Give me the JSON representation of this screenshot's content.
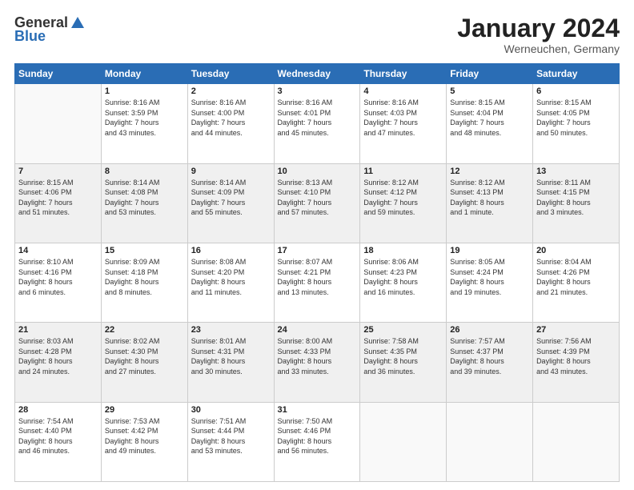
{
  "logo": {
    "general": "General",
    "blue": "Blue"
  },
  "header": {
    "month": "January 2024",
    "location": "Werneuchen, Germany"
  },
  "weekdays": [
    "Sunday",
    "Monday",
    "Tuesday",
    "Wednesday",
    "Thursday",
    "Friday",
    "Saturday"
  ],
  "weeks": [
    [
      {
        "day": "",
        "info": ""
      },
      {
        "day": "1",
        "info": "Sunrise: 8:16 AM\nSunset: 3:59 PM\nDaylight: 7 hours\nand 43 minutes."
      },
      {
        "day": "2",
        "info": "Sunrise: 8:16 AM\nSunset: 4:00 PM\nDaylight: 7 hours\nand 44 minutes."
      },
      {
        "day": "3",
        "info": "Sunrise: 8:16 AM\nSunset: 4:01 PM\nDaylight: 7 hours\nand 45 minutes."
      },
      {
        "day": "4",
        "info": "Sunrise: 8:16 AM\nSunset: 4:03 PM\nDaylight: 7 hours\nand 47 minutes."
      },
      {
        "day": "5",
        "info": "Sunrise: 8:15 AM\nSunset: 4:04 PM\nDaylight: 7 hours\nand 48 minutes."
      },
      {
        "day": "6",
        "info": "Sunrise: 8:15 AM\nSunset: 4:05 PM\nDaylight: 7 hours\nand 50 minutes."
      }
    ],
    [
      {
        "day": "7",
        "info": "Sunrise: 8:15 AM\nSunset: 4:06 PM\nDaylight: 7 hours\nand 51 minutes."
      },
      {
        "day": "8",
        "info": "Sunrise: 8:14 AM\nSunset: 4:08 PM\nDaylight: 7 hours\nand 53 minutes."
      },
      {
        "day": "9",
        "info": "Sunrise: 8:14 AM\nSunset: 4:09 PM\nDaylight: 7 hours\nand 55 minutes."
      },
      {
        "day": "10",
        "info": "Sunrise: 8:13 AM\nSunset: 4:10 PM\nDaylight: 7 hours\nand 57 minutes."
      },
      {
        "day": "11",
        "info": "Sunrise: 8:12 AM\nSunset: 4:12 PM\nDaylight: 7 hours\nand 59 minutes."
      },
      {
        "day": "12",
        "info": "Sunrise: 8:12 AM\nSunset: 4:13 PM\nDaylight: 8 hours\nand 1 minute."
      },
      {
        "day": "13",
        "info": "Sunrise: 8:11 AM\nSunset: 4:15 PM\nDaylight: 8 hours\nand 3 minutes."
      }
    ],
    [
      {
        "day": "14",
        "info": "Sunrise: 8:10 AM\nSunset: 4:16 PM\nDaylight: 8 hours\nand 6 minutes."
      },
      {
        "day": "15",
        "info": "Sunrise: 8:09 AM\nSunset: 4:18 PM\nDaylight: 8 hours\nand 8 minutes."
      },
      {
        "day": "16",
        "info": "Sunrise: 8:08 AM\nSunset: 4:20 PM\nDaylight: 8 hours\nand 11 minutes."
      },
      {
        "day": "17",
        "info": "Sunrise: 8:07 AM\nSunset: 4:21 PM\nDaylight: 8 hours\nand 13 minutes."
      },
      {
        "day": "18",
        "info": "Sunrise: 8:06 AM\nSunset: 4:23 PM\nDaylight: 8 hours\nand 16 minutes."
      },
      {
        "day": "19",
        "info": "Sunrise: 8:05 AM\nSunset: 4:24 PM\nDaylight: 8 hours\nand 19 minutes."
      },
      {
        "day": "20",
        "info": "Sunrise: 8:04 AM\nSunset: 4:26 PM\nDaylight: 8 hours\nand 21 minutes."
      }
    ],
    [
      {
        "day": "21",
        "info": "Sunrise: 8:03 AM\nSunset: 4:28 PM\nDaylight: 8 hours\nand 24 minutes."
      },
      {
        "day": "22",
        "info": "Sunrise: 8:02 AM\nSunset: 4:30 PM\nDaylight: 8 hours\nand 27 minutes."
      },
      {
        "day": "23",
        "info": "Sunrise: 8:01 AM\nSunset: 4:31 PM\nDaylight: 8 hours\nand 30 minutes."
      },
      {
        "day": "24",
        "info": "Sunrise: 8:00 AM\nSunset: 4:33 PM\nDaylight: 8 hours\nand 33 minutes."
      },
      {
        "day": "25",
        "info": "Sunrise: 7:58 AM\nSunset: 4:35 PM\nDaylight: 8 hours\nand 36 minutes."
      },
      {
        "day": "26",
        "info": "Sunrise: 7:57 AM\nSunset: 4:37 PM\nDaylight: 8 hours\nand 39 minutes."
      },
      {
        "day": "27",
        "info": "Sunrise: 7:56 AM\nSunset: 4:39 PM\nDaylight: 8 hours\nand 43 minutes."
      }
    ],
    [
      {
        "day": "28",
        "info": "Sunrise: 7:54 AM\nSunset: 4:40 PM\nDaylight: 8 hours\nand 46 minutes."
      },
      {
        "day": "29",
        "info": "Sunrise: 7:53 AM\nSunset: 4:42 PM\nDaylight: 8 hours\nand 49 minutes."
      },
      {
        "day": "30",
        "info": "Sunrise: 7:51 AM\nSunset: 4:44 PM\nDaylight: 8 hours\nand 53 minutes."
      },
      {
        "day": "31",
        "info": "Sunrise: 7:50 AM\nSunset: 4:46 PM\nDaylight: 8 hours\nand 56 minutes."
      },
      {
        "day": "",
        "info": ""
      },
      {
        "day": "",
        "info": ""
      },
      {
        "day": "",
        "info": ""
      }
    ]
  ]
}
